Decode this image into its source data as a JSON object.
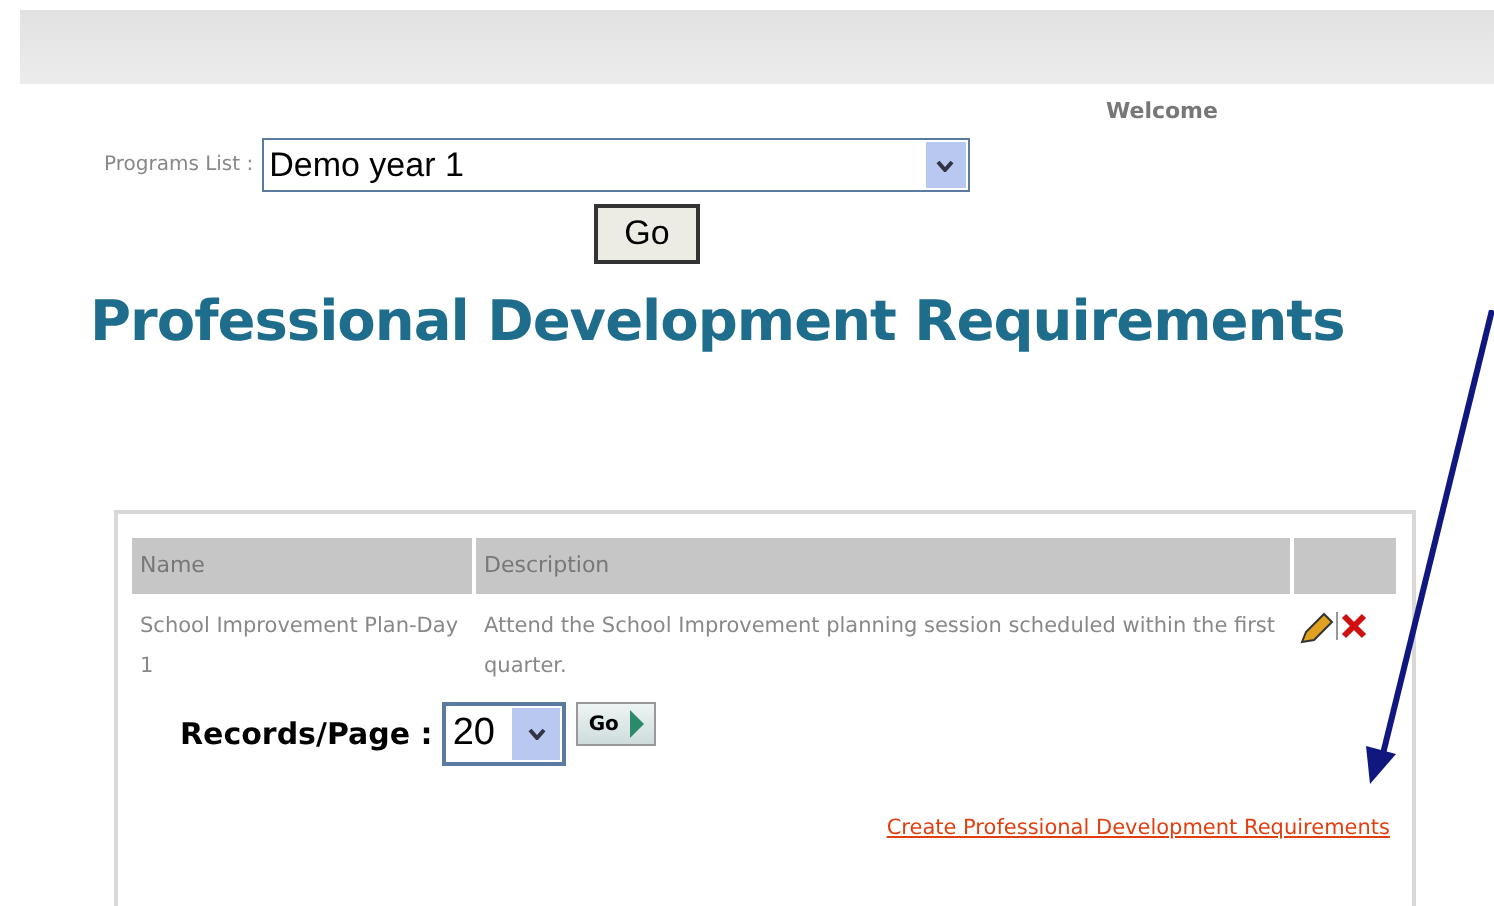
{
  "header": {
    "welcome": "Welcome"
  },
  "programs": {
    "label": "Programs List :",
    "value": "Demo year 1",
    "button": "Go"
  },
  "title": "Professional Development Requirements",
  "table": {
    "columns": [
      "Name",
      "Description",
      ""
    ],
    "rows": [
      {
        "name": "School Improvement Plan-Day 1",
        "description": "Attend the School Improvement planning session scheduled within the first quarter."
      }
    ]
  },
  "paging": {
    "label": "Records/Page :",
    "value": "20",
    "button": "Go"
  },
  "create_link": "Create Professional Development Requirements"
}
